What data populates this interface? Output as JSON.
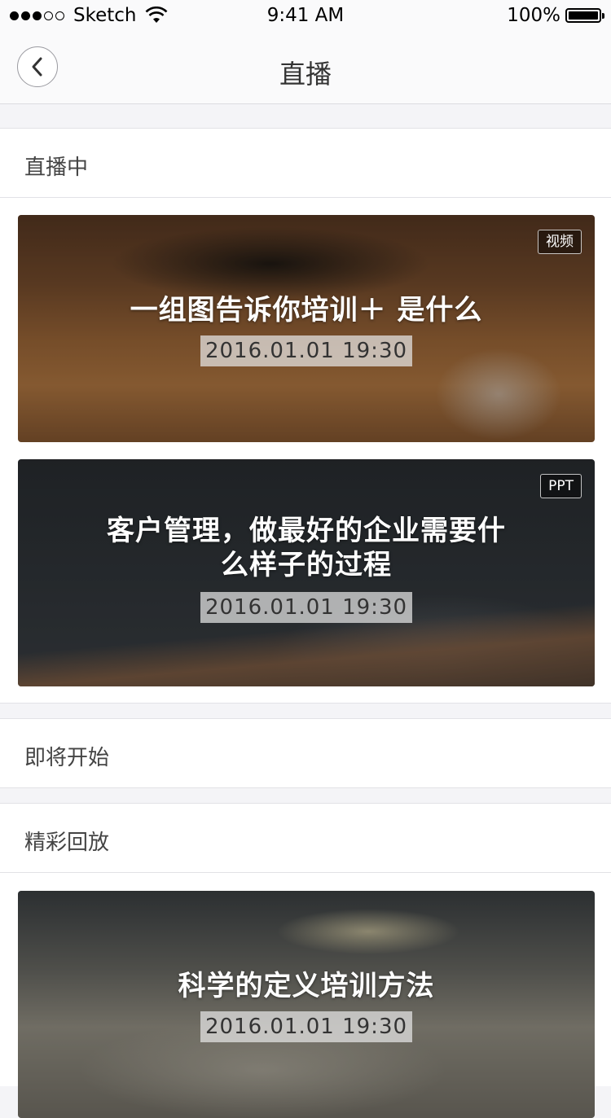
{
  "status_bar": {
    "carrier": "Sketch",
    "time": "9:41 AM",
    "battery": "100%"
  },
  "nav": {
    "title": "直播"
  },
  "sections": {
    "live": {
      "label": "直播中",
      "cards": [
        {
          "title": "一组图告诉你培训＋ 是什么",
          "date": "2016.01.01 19:30",
          "tag": "视频"
        },
        {
          "title": "客户管理，做最好的企业需要什么样子的过程",
          "date": "2016.01.01 19:30",
          "tag": "PPT"
        }
      ]
    },
    "upcoming": {
      "label": "即将开始"
    },
    "replay": {
      "label": "精彩回放",
      "cards": [
        {
          "title": "科学的定义培训方法",
          "date": "2016.01.01 19:30"
        }
      ]
    }
  }
}
